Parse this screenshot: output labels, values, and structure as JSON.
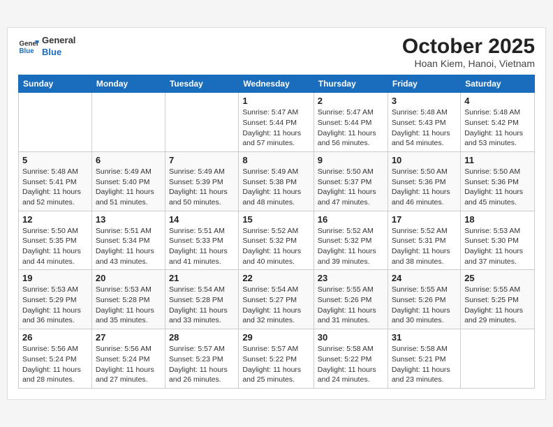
{
  "logo": {
    "general": "General",
    "blue": "Blue"
  },
  "title": "October 2025",
  "subtitle": "Hoan Kiem, Hanoi, Vietnam",
  "headers": [
    "Sunday",
    "Monday",
    "Tuesday",
    "Wednesday",
    "Thursday",
    "Friday",
    "Saturday"
  ],
  "weeks": [
    [
      {
        "day": "",
        "info": ""
      },
      {
        "day": "",
        "info": ""
      },
      {
        "day": "",
        "info": ""
      },
      {
        "day": "1",
        "info": "Sunrise: 5:47 AM\nSunset: 5:44 PM\nDaylight: 11 hours\nand 57 minutes."
      },
      {
        "day": "2",
        "info": "Sunrise: 5:47 AM\nSunset: 5:44 PM\nDaylight: 11 hours\nand 56 minutes."
      },
      {
        "day": "3",
        "info": "Sunrise: 5:48 AM\nSunset: 5:43 PM\nDaylight: 11 hours\nand 54 minutes."
      },
      {
        "day": "4",
        "info": "Sunrise: 5:48 AM\nSunset: 5:42 PM\nDaylight: 11 hours\nand 53 minutes."
      }
    ],
    [
      {
        "day": "5",
        "info": "Sunrise: 5:48 AM\nSunset: 5:41 PM\nDaylight: 11 hours\nand 52 minutes."
      },
      {
        "day": "6",
        "info": "Sunrise: 5:49 AM\nSunset: 5:40 PM\nDaylight: 11 hours\nand 51 minutes."
      },
      {
        "day": "7",
        "info": "Sunrise: 5:49 AM\nSunset: 5:39 PM\nDaylight: 11 hours\nand 50 minutes."
      },
      {
        "day": "8",
        "info": "Sunrise: 5:49 AM\nSunset: 5:38 PM\nDaylight: 11 hours\nand 48 minutes."
      },
      {
        "day": "9",
        "info": "Sunrise: 5:50 AM\nSunset: 5:37 PM\nDaylight: 11 hours\nand 47 minutes."
      },
      {
        "day": "10",
        "info": "Sunrise: 5:50 AM\nSunset: 5:36 PM\nDaylight: 11 hours\nand 46 minutes."
      },
      {
        "day": "11",
        "info": "Sunrise: 5:50 AM\nSunset: 5:36 PM\nDaylight: 11 hours\nand 45 minutes."
      }
    ],
    [
      {
        "day": "12",
        "info": "Sunrise: 5:50 AM\nSunset: 5:35 PM\nDaylight: 11 hours\nand 44 minutes."
      },
      {
        "day": "13",
        "info": "Sunrise: 5:51 AM\nSunset: 5:34 PM\nDaylight: 11 hours\nand 43 minutes."
      },
      {
        "day": "14",
        "info": "Sunrise: 5:51 AM\nSunset: 5:33 PM\nDaylight: 11 hours\nand 41 minutes."
      },
      {
        "day": "15",
        "info": "Sunrise: 5:52 AM\nSunset: 5:32 PM\nDaylight: 11 hours\nand 40 minutes."
      },
      {
        "day": "16",
        "info": "Sunrise: 5:52 AM\nSunset: 5:32 PM\nDaylight: 11 hours\nand 39 minutes."
      },
      {
        "day": "17",
        "info": "Sunrise: 5:52 AM\nSunset: 5:31 PM\nDaylight: 11 hours\nand 38 minutes."
      },
      {
        "day": "18",
        "info": "Sunrise: 5:53 AM\nSunset: 5:30 PM\nDaylight: 11 hours\nand 37 minutes."
      }
    ],
    [
      {
        "day": "19",
        "info": "Sunrise: 5:53 AM\nSunset: 5:29 PM\nDaylight: 11 hours\nand 36 minutes."
      },
      {
        "day": "20",
        "info": "Sunrise: 5:53 AM\nSunset: 5:28 PM\nDaylight: 11 hours\nand 35 minutes."
      },
      {
        "day": "21",
        "info": "Sunrise: 5:54 AM\nSunset: 5:28 PM\nDaylight: 11 hours\nand 33 minutes."
      },
      {
        "day": "22",
        "info": "Sunrise: 5:54 AM\nSunset: 5:27 PM\nDaylight: 11 hours\nand 32 minutes."
      },
      {
        "day": "23",
        "info": "Sunrise: 5:55 AM\nSunset: 5:26 PM\nDaylight: 11 hours\nand 31 minutes."
      },
      {
        "day": "24",
        "info": "Sunrise: 5:55 AM\nSunset: 5:26 PM\nDaylight: 11 hours\nand 30 minutes."
      },
      {
        "day": "25",
        "info": "Sunrise: 5:55 AM\nSunset: 5:25 PM\nDaylight: 11 hours\nand 29 minutes."
      }
    ],
    [
      {
        "day": "26",
        "info": "Sunrise: 5:56 AM\nSunset: 5:24 PM\nDaylight: 11 hours\nand 28 minutes."
      },
      {
        "day": "27",
        "info": "Sunrise: 5:56 AM\nSunset: 5:24 PM\nDaylight: 11 hours\nand 27 minutes."
      },
      {
        "day": "28",
        "info": "Sunrise: 5:57 AM\nSunset: 5:23 PM\nDaylight: 11 hours\nand 26 minutes."
      },
      {
        "day": "29",
        "info": "Sunrise: 5:57 AM\nSunset: 5:22 PM\nDaylight: 11 hours\nand 25 minutes."
      },
      {
        "day": "30",
        "info": "Sunrise: 5:58 AM\nSunset: 5:22 PM\nDaylight: 11 hours\nand 24 minutes."
      },
      {
        "day": "31",
        "info": "Sunrise: 5:58 AM\nSunset: 5:21 PM\nDaylight: 11 hours\nand 23 minutes."
      },
      {
        "day": "",
        "info": ""
      }
    ]
  ]
}
